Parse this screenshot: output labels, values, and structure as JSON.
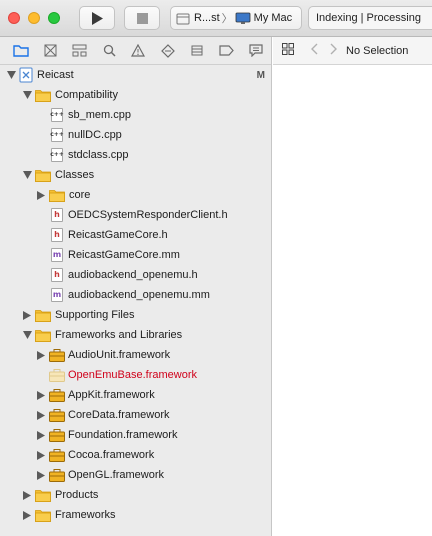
{
  "toolbar": {
    "scheme_project": "R...st",
    "scheme_separator": "〉",
    "scheme_destination": "My Mac",
    "activity_text": "Indexing | Processing"
  },
  "navigator": {
    "tabs": [
      "project-navigator",
      "source-control-navigator",
      "symbol-navigator",
      "find-navigator",
      "issue-navigator",
      "test-navigator",
      "debug-navigator",
      "breakpoint-navigator",
      "report-navigator"
    ],
    "project": {
      "name": "Reicast",
      "badge": "M"
    },
    "tree": [
      {
        "label": "Compatibility",
        "type": "group",
        "level": 1,
        "expanded": true
      },
      {
        "label": "sb_mem.cpp",
        "type": "cpp",
        "level": 2
      },
      {
        "label": "nullDC.cpp",
        "type": "cpp",
        "level": 2
      },
      {
        "label": "stdclass.cpp",
        "type": "cpp",
        "level": 2
      },
      {
        "label": "Classes",
        "type": "group",
        "level": 1,
        "expanded": true
      },
      {
        "label": "core",
        "type": "group",
        "level": 2,
        "expanded": false
      },
      {
        "label": "OEDCSystemResponderClient.h",
        "type": "h",
        "level": 2
      },
      {
        "label": "ReicastGameCore.h",
        "type": "h",
        "level": 2
      },
      {
        "label": "ReicastGameCore.mm",
        "type": "m",
        "level": 2
      },
      {
        "label": "audiobackend_openemu.h",
        "type": "h",
        "level": 2
      },
      {
        "label": "audiobackend_openemu.mm",
        "type": "m",
        "level": 2
      },
      {
        "label": "Supporting Files",
        "type": "group",
        "level": 1,
        "expanded": false
      },
      {
        "label": "Frameworks and Libraries",
        "type": "group",
        "level": 1,
        "expanded": true
      },
      {
        "label": "AudioUnit.framework",
        "type": "framework",
        "level": 2,
        "expanded": false
      },
      {
        "label": "OpenEmuBase.framework",
        "type": "framework-missing",
        "level": 2,
        "missing": true
      },
      {
        "label": "AppKit.framework",
        "type": "framework",
        "level": 2,
        "expanded": false
      },
      {
        "label": "CoreData.framework",
        "type": "framework",
        "level": 2,
        "expanded": false
      },
      {
        "label": "Foundation.framework",
        "type": "framework",
        "level": 2,
        "expanded": false
      },
      {
        "label": "Cocoa.framework",
        "type": "framework",
        "level": 2,
        "expanded": false
      },
      {
        "label": "OpenGL.framework",
        "type": "framework",
        "level": 2,
        "expanded": false
      },
      {
        "label": "Products",
        "type": "group",
        "level": 1,
        "expanded": false
      },
      {
        "label": "Frameworks",
        "type": "group",
        "level": 1,
        "expanded": false
      }
    ]
  },
  "editor": {
    "no_selection": "No Selection"
  },
  "colors": {
    "folder": "#f5c032",
    "missing_text": "#d0021b",
    "selected_tab": "#1a73e8"
  }
}
